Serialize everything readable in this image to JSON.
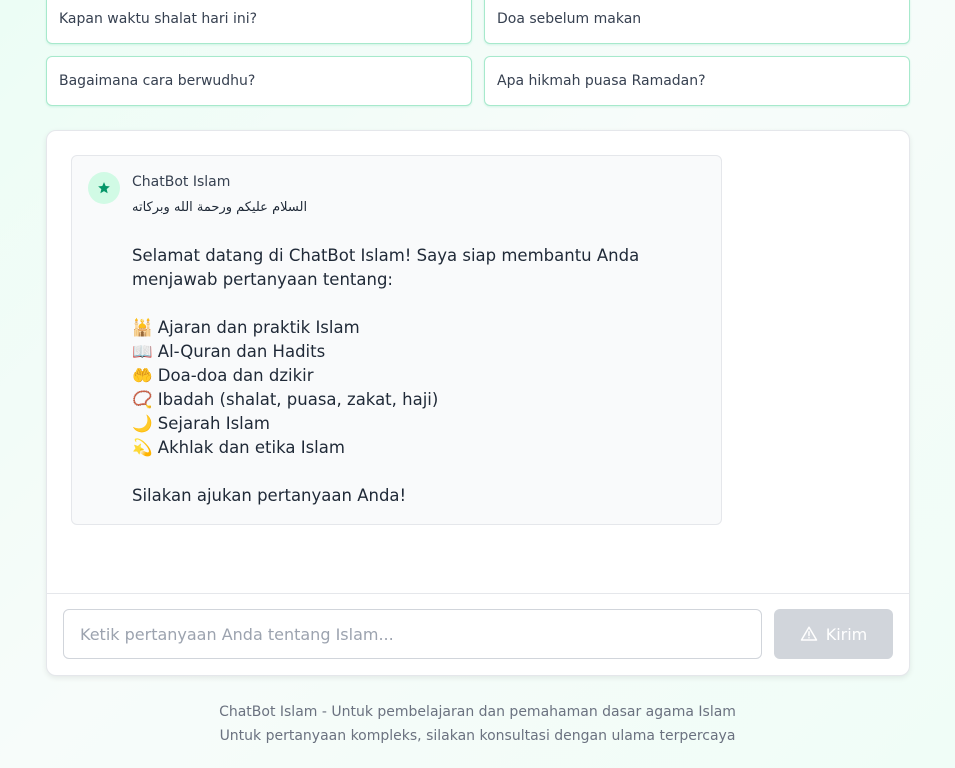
{
  "suggestions": [
    {
      "label": "Kapan waktu shalat hari ini?"
    },
    {
      "label": "Doa sebelum makan"
    },
    {
      "label": "Bagaimana cara berwudhu?"
    },
    {
      "label": "Apa hikmah puasa Ramadan?"
    }
  ],
  "chat": {
    "bot_name": "ChatBot Islam",
    "avatar_icon": "star-icon",
    "greeting_arabic": "السلام عليكم ورحمة الله وبركاته",
    "intro": "Selamat datang di ChatBot Islam! Saya siap membantu Anda menjawab pertanyaan tentang:",
    "topics": [
      {
        "emoji": "🕌",
        "text": "Ajaran dan praktik Islam"
      },
      {
        "emoji": "📖",
        "text": "Al-Quran dan Hadits"
      },
      {
        "emoji": "🤲",
        "text": "Doa-doa dan dzikir"
      },
      {
        "emoji": "📿",
        "text": "Ibadah (shalat, puasa, zakat, haji)"
      },
      {
        "emoji": "🌙",
        "text": "Sejarah Islam"
      },
      {
        "emoji": "💫",
        "text": "Akhlak dan etika Islam"
      }
    ],
    "closing": "Silakan ajukan pertanyaan Anda!"
  },
  "input": {
    "placeholder": "Ketik pertanyaan Anda tentang Islam...",
    "value": ""
  },
  "send_button": {
    "label": "Kirim",
    "icon": "warning-icon"
  },
  "footer": {
    "line1": "ChatBot Islam - Untuk pembelajaran dan pemahaman dasar agama Islam",
    "line2": "Untuk pertanyaan kompleks, silakan konsultasi dengan ulama terpercaya"
  },
  "colors": {
    "accent": "#059669",
    "suggestion_border": "#a7e9cc",
    "button_disabled": "#d1d5db"
  }
}
